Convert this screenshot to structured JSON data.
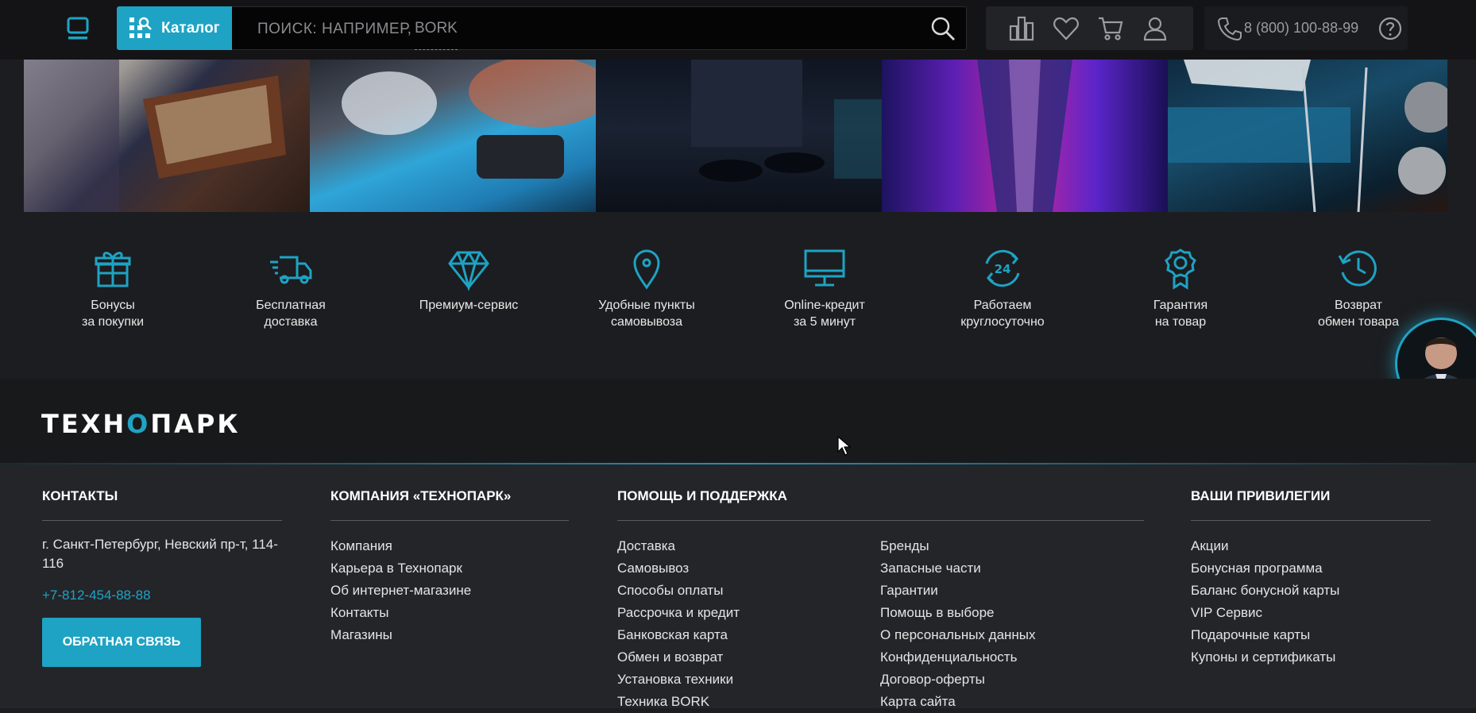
{
  "header": {
    "catalog_label": "Каталог",
    "search_placeholder": "ПОИСК: НАПРИМЕР,",
    "search_brand_hint": "BORK",
    "phone": "8 (800) 100-88-99"
  },
  "features": [
    {
      "icon": "gift-icon",
      "label": "Бонусы\nза покупки"
    },
    {
      "icon": "truck-icon",
      "label": "Бесплатная\nдоставка"
    },
    {
      "icon": "diamond-icon",
      "label": "Премиум-сервис"
    },
    {
      "icon": "map-pin-icon",
      "label": "Удобные пункты\nсамовывоза"
    },
    {
      "icon": "monitor-icon",
      "label": "Online-кредит\nза 5 минут"
    },
    {
      "icon": "24h-icon",
      "label": "Работаем\nкруглосуточно"
    },
    {
      "icon": "award-icon",
      "label": "Гарантия\nна товар"
    },
    {
      "icon": "clock-return-icon",
      "label": "Возврат\nобмен товара"
    }
  ],
  "brand": {
    "name_part1": "ТЕХН",
    "name_o": "О",
    "name_part2": "ПАРК"
  },
  "footer": {
    "contacts": {
      "title": "КОНТАКТЫ",
      "address": "г. Санкт-Петербург, Невский пр-т, 114-116",
      "phone": "+7-812-454-88-88",
      "feedback_button": "ОБРАТНАЯ СВЯЗЬ"
    },
    "company": {
      "title": "КОМПАНИЯ «ТЕХНОПАРК»",
      "items": [
        "Компания",
        "Карьера в Технопарк",
        "Об интернет-магазине",
        "Контакты",
        "Магазины"
      ]
    },
    "help": {
      "title": "ПОМОЩЬ И ПОДДЕРЖКА",
      "items_left": [
        "Доставка",
        "Самовывоз",
        "Способы оплаты",
        "Рассрочка и кредит",
        "Банковская карта",
        "Обмен и возврат",
        "Установка техники",
        "Техника BORK"
      ],
      "items_right": [
        "Бренды",
        "Запасные части",
        "Гарантии",
        "Помощь в выборе",
        "О персональных данных",
        "Конфиденциальность",
        "Договор-оферты",
        "Карта сайта"
      ]
    },
    "privileges": {
      "title": "ВАШИ ПРИВИЛЕГИИ",
      "items": [
        "Акции",
        "Бонусная программа",
        "Баланс бонусной карты",
        "VIP Сервис",
        "Подарочные карты",
        "Купоны и сертификаты"
      ]
    }
  },
  "colors": {
    "accent": "#1ea3c4",
    "background": "#1c1d20",
    "footer": "#242529"
  }
}
